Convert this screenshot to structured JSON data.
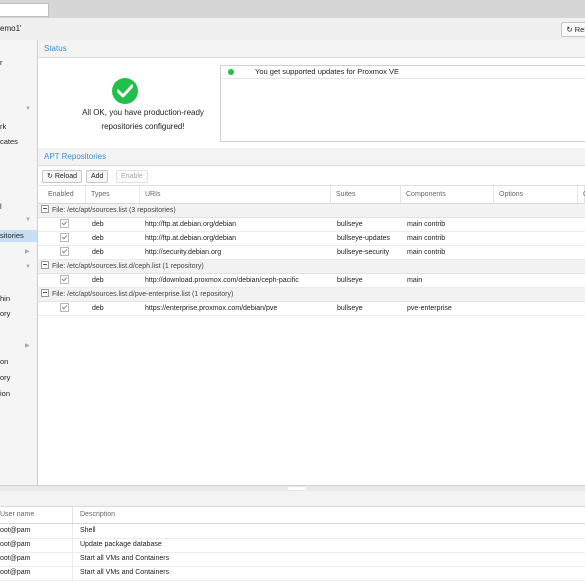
{
  "window": {
    "title": "emo1'",
    "reload_label": "Rel"
  },
  "sidebar": {
    "items": [
      {
        "label": "r"
      },
      {
        "label": "rk"
      },
      {
        "label": "cates"
      },
      {
        "label": "l"
      },
      {
        "label": "sitories"
      },
      {
        "label": "hin"
      },
      {
        "label": "ory"
      },
      {
        "label": "on"
      },
      {
        "label": "ory"
      },
      {
        "label": "ion"
      }
    ]
  },
  "status": {
    "header": "Status",
    "ok_line1": "All OK, you have production-ready",
    "ok_line2": "repositories configured!",
    "message": "You get supported updates for Proxmox VE"
  },
  "repositories": {
    "header": "APT Repositories",
    "toolbar": {
      "reload": "Reload",
      "add": "Add",
      "enable": "Enable"
    },
    "columns": [
      "Enabled",
      "Types",
      "URIs",
      "Suites",
      "Components",
      "Options",
      "C"
    ],
    "groups": [
      {
        "title": "File: /etc/apt/sources.list (3 repositories)",
        "rows": [
          {
            "type": "deb",
            "uri": "http://ftp.at.debian.org/debian",
            "suite": "bullseye",
            "components": "main contrib"
          },
          {
            "type": "deb",
            "uri": "http://ftp.at.debian.org/debian",
            "suite": "bullseye-updates",
            "components": "main contrib"
          },
          {
            "type": "deb",
            "uri": "http://security.debian.org",
            "suite": "bullseye-security",
            "components": "main contrib"
          }
        ]
      },
      {
        "title": "File: /etc/apt/sources.list.d/ceph.list (1 repository)",
        "rows": [
          {
            "type": "deb",
            "uri": "http://download.proxmox.com/debian/ceph-pacific",
            "suite": "bullseye",
            "components": "main"
          }
        ]
      },
      {
        "title": "File: /etc/apt/sources.list.d/pve-enterprise.list (1 repository)",
        "rows": [
          {
            "type": "deb",
            "uri": "https://enterprise.proxmox.com/debian/pve",
            "suite": "bullseye",
            "components": "pve-enterprise"
          }
        ]
      }
    ]
  },
  "tasks": {
    "columns": [
      "User name",
      "Description"
    ],
    "rows": [
      {
        "user": "oot@pam",
        "description": "Shell"
      },
      {
        "user": "oot@pam",
        "description": "Update package database"
      },
      {
        "user": "oot@pam",
        "description": "Start all VMs and Containers"
      },
      {
        "user": "oot@pam",
        "description": "Start all VMs and Containers"
      }
    ]
  }
}
